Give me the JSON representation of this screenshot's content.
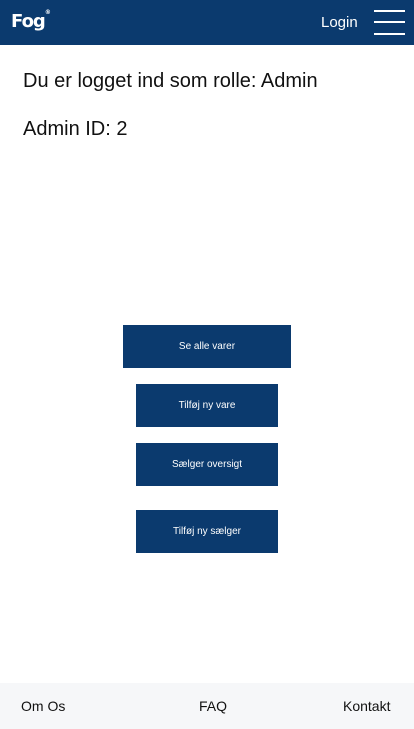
{
  "header": {
    "logo_text": "Fog",
    "logo_mark": "®",
    "login_label": "Login",
    "menu_icon": "hamburger-menu-icon"
  },
  "main": {
    "role_text": "Du er logget ind som rolle: Admin",
    "admin_id_text": "Admin ID: 2",
    "buttons": [
      {
        "label": "Se alle varer"
      },
      {
        "label": "Tilføj ny vare"
      },
      {
        "label": "Sælger oversigt"
      },
      {
        "label": "Tilføj ny sælger"
      }
    ]
  },
  "footer": {
    "links": [
      {
        "label": "Om Os"
      },
      {
        "label": "FAQ"
      },
      {
        "label": "Kontakt"
      }
    ]
  },
  "colors": {
    "brand": "#0b3a6e",
    "footer_bg": "#f6f7f9"
  }
}
